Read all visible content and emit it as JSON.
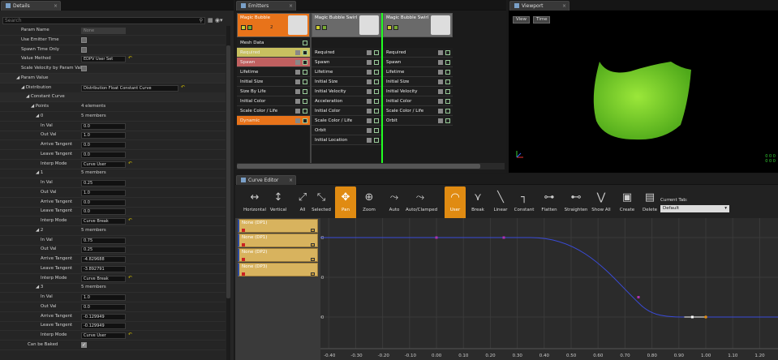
{
  "details": {
    "tab": "Details",
    "search_placeholder": "Search",
    "rows": [
      {
        "label": "Param Name",
        "value": "None",
        "kind": "input"
      },
      {
        "label": "Use Emitter Time",
        "kind": "check"
      },
      {
        "label": "Spawn Time Only",
        "kind": "check"
      },
      {
        "label": "Value Method",
        "value": "EDPV User Set",
        "kind": "drop"
      },
      {
        "label": "Scale Velocity by Param Val",
        "kind": "check"
      },
      {
        "label": "◢ Param Value",
        "kind": "group"
      },
      {
        "label": "◢ Distribution",
        "value": "Distribution Float Constant Curve",
        "kind": "drop"
      },
      {
        "label": "◢ Constant Curve",
        "kind": "group"
      },
      {
        "label": "◢ Points",
        "value": "4 elements",
        "kind": "text"
      },
      {
        "label": "◢ 0",
        "value": "5 members",
        "kind": "text"
      },
      {
        "label": "In Val",
        "value": "0.0",
        "kind": "input"
      },
      {
        "label": "Out Val",
        "value": "1.0",
        "kind": "input"
      },
      {
        "label": "Arrive Tangent",
        "value": "0.0",
        "kind": "input"
      },
      {
        "label": "Leave Tangent",
        "value": "0.0",
        "kind": "input"
      },
      {
        "label": "Interp Mode",
        "value": "Curve User",
        "kind": "drop"
      },
      {
        "label": "◢ 1",
        "value": "5 members",
        "kind": "text"
      },
      {
        "label": "In Val",
        "value": "0.25",
        "kind": "input"
      },
      {
        "label": "Out Val",
        "value": "1.0",
        "kind": "input"
      },
      {
        "label": "Arrive Tangent",
        "value": "0.0",
        "kind": "input"
      },
      {
        "label": "Leave Tangent",
        "value": "0.0",
        "kind": "input"
      },
      {
        "label": "Interp Mode",
        "value": "Curve Break",
        "kind": "drop"
      },
      {
        "label": "◢ 2",
        "value": "5 members",
        "kind": "text"
      },
      {
        "label": "In Val",
        "value": "0.75",
        "kind": "input"
      },
      {
        "label": "Out Val",
        "value": "0.25",
        "kind": "input"
      },
      {
        "label": "Arrive Tangent",
        "value": "-4.829688",
        "kind": "input"
      },
      {
        "label": "Leave Tangent",
        "value": "-3.892791",
        "kind": "input"
      },
      {
        "label": "Interp Mode",
        "value": "Curve Break",
        "kind": "drop"
      },
      {
        "label": "◢ 3",
        "value": "5 members",
        "kind": "text"
      },
      {
        "label": "In Val",
        "value": "1.0",
        "kind": "input"
      },
      {
        "label": "Out Val",
        "value": "0.0",
        "kind": "input"
      },
      {
        "label": "Arrive Tangent",
        "value": "-0.129949",
        "kind": "input"
      },
      {
        "label": "Leave Tangent",
        "value": "-0.129949",
        "kind": "input"
      },
      {
        "label": "Interp Mode",
        "value": "Curve User",
        "kind": "drop"
      },
      {
        "label": "Can be Baked",
        "kind": "checkon"
      }
    ]
  },
  "emitters": {
    "tab": "Emitters",
    "columns": [
      {
        "name": "Magic Bubble",
        "count": "2",
        "color": "#e8731a",
        "modules": [
          {
            "label": "Mesh Data",
            "bg": "#1e1e1e"
          },
          {
            "label": "Required",
            "bg": "#c8c060"
          },
          {
            "label": "Spawn",
            "bg": "#c06060"
          },
          {
            "label": "Lifetime",
            "bg": "#1e1e1e"
          },
          {
            "label": "Initial Size",
            "bg": "#1e1e1e"
          },
          {
            "label": "Size By Life",
            "bg": "#1e1e1e"
          },
          {
            "label": "Initial Color",
            "bg": "#1e1e1e"
          },
          {
            "label": "Scale Color / Life",
            "bg": "#1e1e1e"
          },
          {
            "label": "Dynamic",
            "bg": "#e8731a"
          }
        ]
      },
      {
        "name": "Magic Bubble Swirl",
        "count": "",
        "color": "#5a5a5a",
        "modules": [
          {
            "label": "Required"
          },
          {
            "label": "Spawn"
          },
          {
            "label": "Lifetime"
          },
          {
            "label": "Initial Size"
          },
          {
            "label": "Initial Velocity"
          },
          {
            "label": "Acceleration"
          },
          {
            "label": "Initial Color"
          },
          {
            "label": "Scale Color / Life"
          },
          {
            "label": "Orbit"
          },
          {
            "label": "Initial Location"
          }
        ]
      },
      {
        "name": "Magic Bubble Swirl",
        "count": "",
        "color": "#5a5a5a",
        "modules": [
          {
            "label": "Required"
          },
          {
            "label": "Spawn"
          },
          {
            "label": "Lifetime"
          },
          {
            "label": "Initial Size"
          },
          {
            "label": "Initial Velocity"
          },
          {
            "label": "Initial Color"
          },
          {
            "label": "Scale Color / Life"
          },
          {
            "label": "Orbit"
          }
        ]
      }
    ]
  },
  "viewport": {
    "tab": "Viewport",
    "view_label": "View",
    "time_label": "Time",
    "corner": "0 0 0\n0 0 0"
  },
  "curve_editor": {
    "tab": "Curve Editor",
    "tools": [
      {
        "label": "Horizontal",
        "icon": "↔"
      },
      {
        "label": "Vertical",
        "icon": "↕"
      },
      {
        "label": "All",
        "icon": "⤢"
      },
      {
        "label": "Selected",
        "icon": "⤡"
      },
      {
        "label": "Pan",
        "icon": "✥",
        "sel": true
      },
      {
        "label": "Zoom",
        "icon": "⊕"
      },
      {
        "label": "Auto",
        "icon": "⤳"
      },
      {
        "label": "Auto/Clamped",
        "icon": "⤳"
      },
      {
        "label": "User",
        "icon": "◠",
        "sel": true
      },
      {
        "label": "Break",
        "icon": "⋎"
      },
      {
        "label": "Linear",
        "icon": "╲"
      },
      {
        "label": "Constant",
        "icon": "┐"
      },
      {
        "label": "Flatten",
        "icon": "⊶"
      },
      {
        "label": "Straighten",
        "icon": "⊷"
      },
      {
        "label": "Show All",
        "icon": "⋁"
      },
      {
        "label": "Create",
        "icon": "▣"
      },
      {
        "label": "Delete",
        "icon": "▤"
      }
    ],
    "current_tab_label": "Current Tab:",
    "current_tab_value": "Default",
    "tracks": [
      "None (DP1)",
      "None (DP1)",
      "None (DP2)",
      "None (DP3)"
    ],
    "y_labels": [
      "1.00",
      "0.50",
      "0.00"
    ],
    "x_labels": [
      "-0.40",
      "-0.30",
      "-0.20",
      "-0.10",
      "0.00",
      "0.10",
      "0.20",
      "0.30",
      "0.40",
      "0.50",
      "0.60",
      "0.70",
      "0.80",
      "0.90",
      "1.00",
      "1.10",
      "1.20"
    ]
  }
}
